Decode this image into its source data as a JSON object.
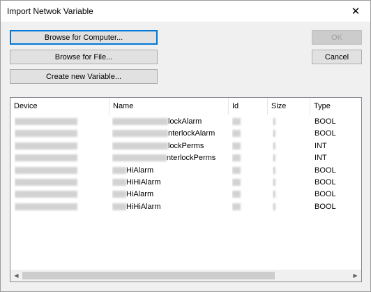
{
  "window": {
    "title": "Import Netwok Variable"
  },
  "buttons": {
    "browse_computer": "Browse for Computer...",
    "browse_file": "Browse for File...",
    "create_variable": "Create new Variable...",
    "ok": "OK",
    "cancel": "Cancel"
  },
  "table": {
    "columns": [
      "Device",
      "Name",
      "Id",
      "Size",
      "Type"
    ],
    "rows": [
      {
        "name_suffix": "lockAlarm",
        "type": "BOOL"
      },
      {
        "name_suffix": "nterlockAlarm",
        "type": "BOOL"
      },
      {
        "name_suffix": "lockPerms",
        "type": "INT"
      },
      {
        "name_suffix": "nterlockPerms",
        "type": "INT"
      },
      {
        "name_suffix": "HiAlarm",
        "type": "BOOL"
      },
      {
        "name_suffix": "HiHiAlarm",
        "type": "BOOL"
      },
      {
        "name_suffix": "HiAlarm",
        "type": "BOOL"
      },
      {
        "name_suffix": "HiHiAlarm",
        "type": "BOOL"
      }
    ]
  },
  "icons": {
    "close": "close-icon",
    "scroll_left": "scroll-left-icon",
    "scroll_right": "scroll-right-icon"
  }
}
